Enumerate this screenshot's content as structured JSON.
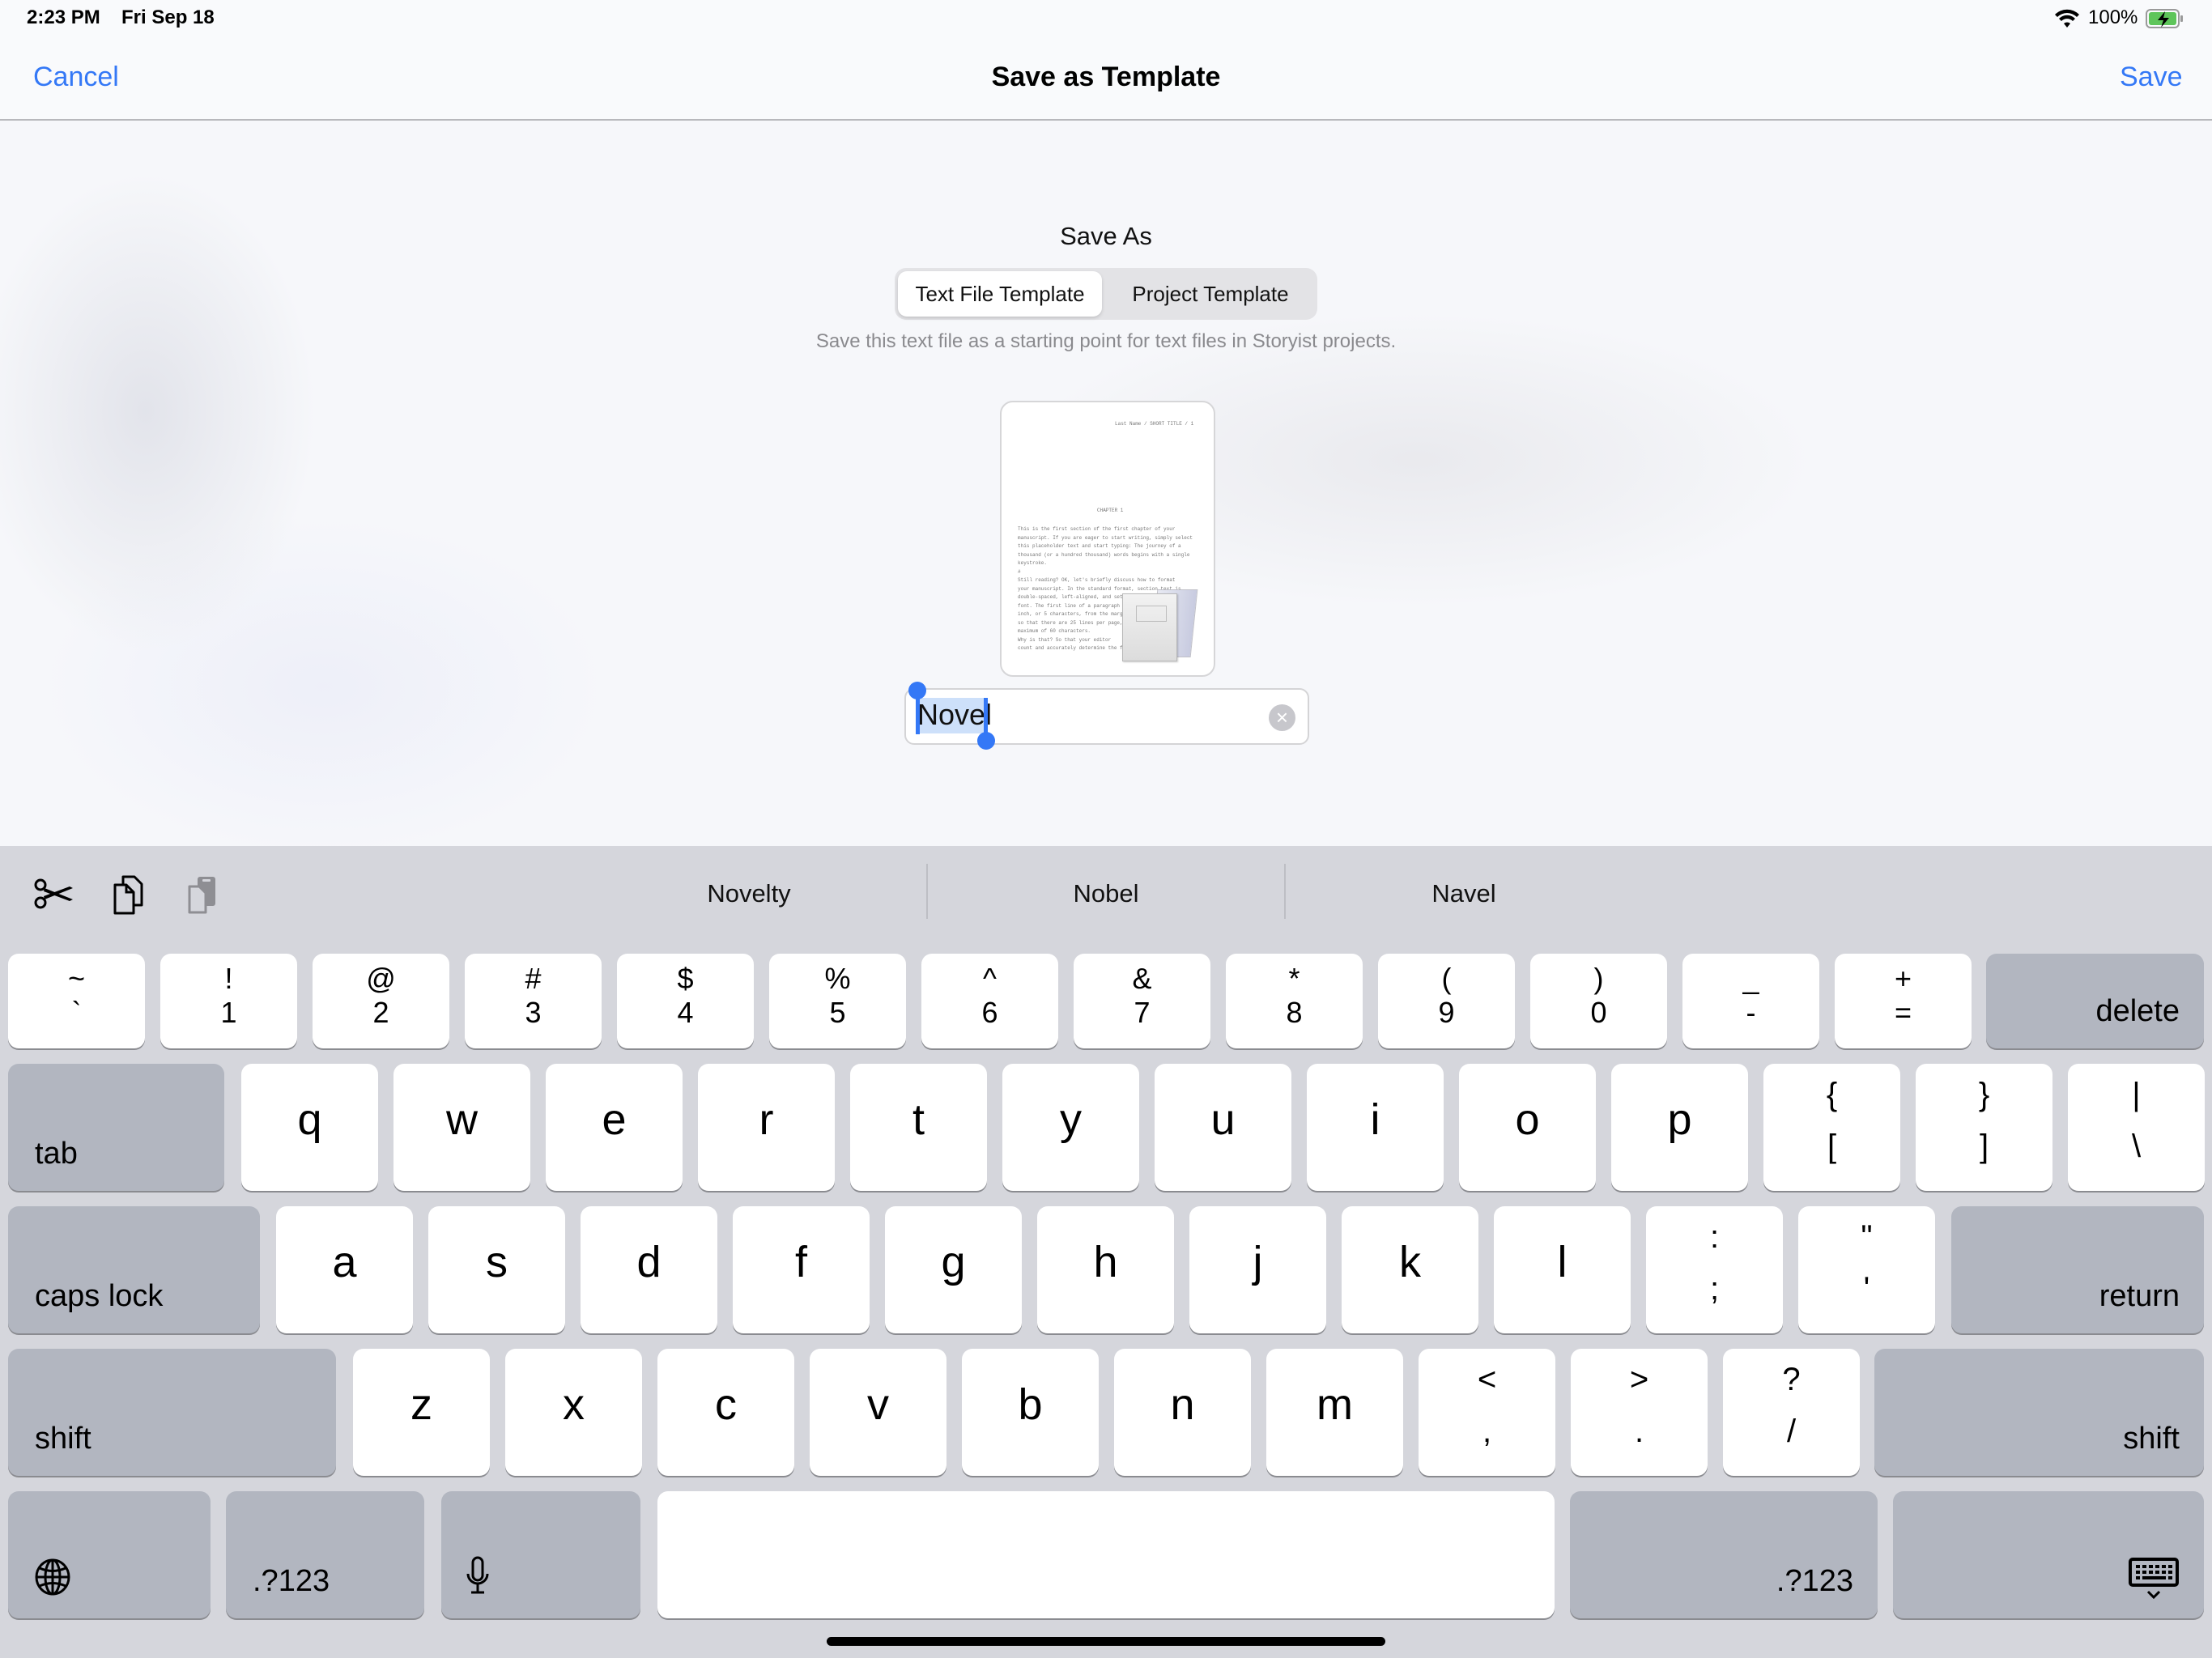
{
  "status_bar": {
    "time": "2:23 PM",
    "date": "Fri Sep 18",
    "battery": "100%",
    "wifi_icon": "wifi-icon",
    "battery_icon": "battery-charging-icon"
  },
  "navbar": {
    "cancel_label": "Cancel",
    "title": "Save as Template",
    "save_label": "Save",
    "accent_color": "#3478f6"
  },
  "save_as": {
    "label": "Save As",
    "options": [
      {
        "label": "Text File Template",
        "selected": true
      },
      {
        "label": "Project Template",
        "selected": false
      }
    ],
    "description": "Save this text file as a starting point for text files in Storyist projects."
  },
  "thumbnail": {
    "header": "Last Name / SHORT TITLE / 1",
    "chapter": "CHAPTER 1",
    "lines": [
      "     This is the first section of the first chapter of your",
      "manuscript.  If you are eager to start writing, simply select",
      "this placeholder text and start typing: The journey of a",
      "thousand (or a hundred thousand) words begins with a single",
      "keystroke.",
      "                              #",
      "     Still reading? OK, let's briefly discuss how to format",
      "your manuscript. In the standard format, section text is",
      "double-spaced, left-aligned, and set in a 12-",
      "font. The first line of a paragraph is",
      "inch, or 5 characters, from the margin",
      "so that there are 25 lines per page, w",
      "maximum of 60 characters.",
      "     Why is that?  So that your editor",
      "count and accurately determine the fi"
    ]
  },
  "name_field": {
    "value": "Novel",
    "selected_text": "Novel",
    "clear_icon": "clear-icon"
  },
  "keyboard": {
    "toolbar": {
      "cut_icon": "scissors-icon",
      "copy_icon": "copy-icon",
      "paste_icon": "paste-icon"
    },
    "suggestions": [
      "Novelty",
      "Nobel",
      "Navel"
    ],
    "row1": [
      {
        "top": "~",
        "bot": "`"
      },
      {
        "top": "!",
        "bot": "1"
      },
      {
        "top": "@",
        "bot": "2"
      },
      {
        "top": "#",
        "bot": "3"
      },
      {
        "top": "$",
        "bot": "4"
      },
      {
        "top": "%",
        "bot": "5"
      },
      {
        "top": "^",
        "bot": "6"
      },
      {
        "top": "&",
        "bot": "7"
      },
      {
        "top": "*",
        "bot": "8"
      },
      {
        "top": "(",
        "bot": "9"
      },
      {
        "top": ")",
        "bot": "0"
      },
      {
        "top": "_",
        "bot": "-"
      },
      {
        "top": "+",
        "bot": "="
      }
    ],
    "delete_label": "delete",
    "tab_label": "tab",
    "row2": [
      "q",
      "w",
      "e",
      "r",
      "t",
      "y",
      "u",
      "i",
      "o",
      "p"
    ],
    "row2_sym": [
      {
        "top": "{",
        "bot": "["
      },
      {
        "top": "}",
        "bot": "]"
      },
      {
        "top": "|",
        "bot": "\\"
      }
    ],
    "caps_label": "caps lock",
    "row3": [
      "a",
      "s",
      "d",
      "f",
      "g",
      "h",
      "j",
      "k",
      "l"
    ],
    "row3_sym": [
      {
        "top": ":",
        "bot": ";"
      },
      {
        "top": "\"",
        "bot": "'"
      }
    ],
    "return_label": "return",
    "shift_label": "shift",
    "row4": [
      "z",
      "x",
      "c",
      "v",
      "b",
      "n",
      "m"
    ],
    "row4_sym": [
      {
        "top": "<",
        "bot": ","
      },
      {
        "top": ">",
        "bot": "."
      },
      {
        "top": "?",
        "bot": "/"
      }
    ],
    "numbers_label": ".?123",
    "globe_icon": "globe-icon",
    "mic_icon": "microphone-icon",
    "dismiss_icon": "keyboard-dismiss-icon"
  }
}
